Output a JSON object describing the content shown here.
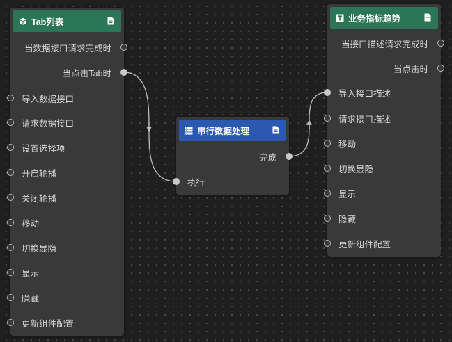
{
  "colors": {
    "canvas_bg": "#1f1f1f",
    "node_bg": "#393939",
    "header_green": "#2a7656",
    "header_blue": "#2b59b2",
    "text": "#d6d6d6",
    "wire": "#bdbdbd"
  },
  "nodes": {
    "tab_list": {
      "title": "Tab列表",
      "icon": "cube-icon",
      "outputs": [
        "当数据接口请求完成时",
        "当点击Tab时"
      ],
      "inputs": [
        "导入数据接口",
        "请求数据接口",
        "设置选择项",
        "开启轮播",
        "关闭轮播",
        "移动",
        "切换显隐",
        "显示",
        "隐藏",
        "更新组件配置"
      ]
    },
    "serial_process": {
      "title": "串行数据处理",
      "icon": "stack-icon",
      "outputs": [
        "完成"
      ],
      "inputs": [
        "执行"
      ]
    },
    "biz_trend": {
      "title": "业务指标趋势",
      "icon": "text-box-icon",
      "outputs": [
        "当接口描述请求完成时",
        "当点击时"
      ],
      "inputs": [
        "导入接口描述",
        "请求接口描述",
        "移动",
        "切换显隐",
        "显示",
        "隐藏",
        "更新组件配置"
      ]
    }
  }
}
